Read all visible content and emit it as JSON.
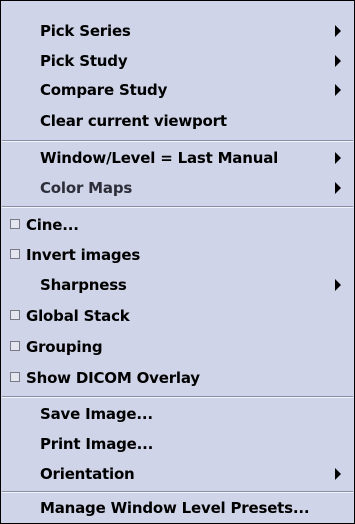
{
  "menu": {
    "pick_series": "Pick Series",
    "pick_study": "Pick Study",
    "compare_study": "Compare Study",
    "clear_viewport": "Clear current viewport",
    "window_level": "Window/Level = Last Manual",
    "color_maps": "Color Maps",
    "cine": "Cine...",
    "invert_images": "Invert images",
    "sharpness": "Sharpness",
    "global_stack": "Global Stack",
    "grouping": "Grouping",
    "show_dicom_overlay": "Show DICOM Overlay",
    "save_image": "Save Image...",
    "print_image": "Print Image...",
    "orientation": "Orientation",
    "manage_presets": "Manage Window Level Presets..."
  },
  "checkboxes": {
    "cine": false,
    "invert_images": false,
    "global_stack": false,
    "grouping": false,
    "show_dicom_overlay": false
  },
  "colors": {
    "menu_background": "#cfd4e8",
    "separator_dark": "#8a8ea4",
    "separator_light": "#f4f5fa",
    "text": "#000000"
  }
}
